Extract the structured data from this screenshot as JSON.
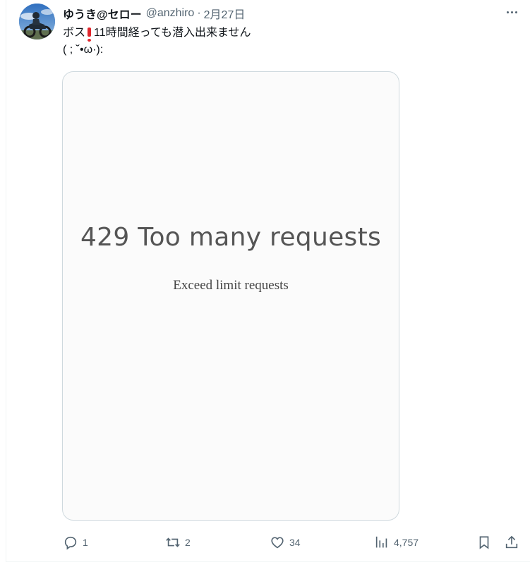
{
  "tweet": {
    "display_name": "ゆうき@セロー",
    "handle": "@anzhiro",
    "separator": "·",
    "date": "2月27日",
    "text_line1_start": "ボス",
    "text_line1_emoji": "heavy-exclamation-mark-icon",
    "text_line1_end": "11時間経っても潜入出来ません",
    "text_line2": "( ; ˘•ω·):"
  },
  "media": {
    "title": "429 Too many requests",
    "subtitle": "Exceed limit requests"
  },
  "actions": {
    "replies": "1",
    "retweets": "2",
    "likes": "34",
    "views": "4,757"
  },
  "icons": {
    "avatar": "motorcycle-rider-avatar",
    "more": "more-options-icon",
    "reply": "reply-icon",
    "retweet": "retweet-icon",
    "like": "heart-icon",
    "views": "analytics-icon",
    "bookmark": "bookmark-icon",
    "share": "share-icon"
  },
  "colors": {
    "text_primary": "#0f1419",
    "text_secondary": "#536471",
    "border": "#cfd9de",
    "emoji_red": "#e0262c"
  }
}
